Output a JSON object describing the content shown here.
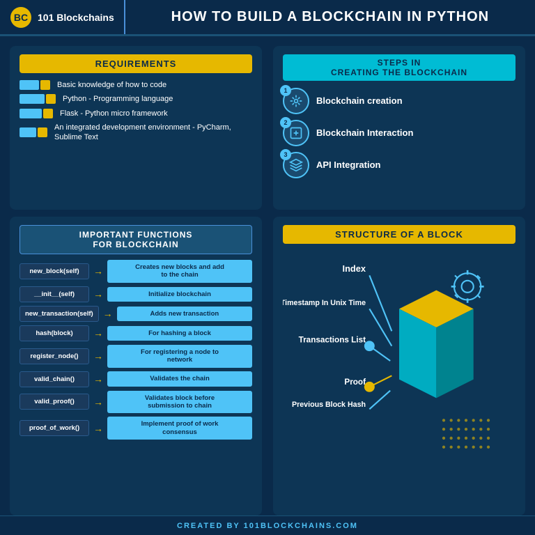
{
  "header": {
    "logo_text": "101 Blockchains",
    "title": "HOW TO BUILD A BLOCKCHAIN IN PYTHON"
  },
  "requirements": {
    "section_title": "REQUIREMENTS",
    "items": [
      {
        "text": "Basic knowledge of how to code"
      },
      {
        "text": "Python - Programming language"
      },
      {
        "text": "Flask - Python micro framework"
      },
      {
        "text": "An integrated development environment - PyCharm, Sublime Text"
      }
    ]
  },
  "steps": {
    "section_title": "STEPS IN\nCREATING THE BLOCKCHAIN",
    "items": [
      {
        "number": "1",
        "label": "Blockchain creation"
      },
      {
        "number": "2",
        "label": "Blockchain Interaction"
      },
      {
        "number": "3",
        "label": "API Integration"
      }
    ]
  },
  "functions": {
    "section_title": "IMPORTANT FUNCTIONS\nFOR BLOCKCHAIN",
    "items": [
      {
        "name": "new_block(self)",
        "desc": "Creates new blocks and add\nto the chain"
      },
      {
        "name": "__init__(self)",
        "desc": "Initialize blockchain"
      },
      {
        "name": "new_transaction(self)",
        "desc": "Adds new transaction"
      },
      {
        "name": "hash(block)",
        "desc": "For hashing a block"
      },
      {
        "name": "register_node()",
        "desc": "For registering a node to\nnetwork"
      },
      {
        "name": "valid_chain()",
        "desc": "Validates the chain"
      },
      {
        "name": "valid_proof()",
        "desc": "Validates block before\nsubmission to chain"
      },
      {
        "name": "proof_of_work()",
        "desc": "Implement proof of work\nconsensus"
      }
    ],
    "arrow": "→"
  },
  "block_structure": {
    "section_title": "STRUCTURE OF A BLOCK",
    "labels": [
      "Index",
      "Timestamp In Unix Time",
      "Transactions List",
      "Proof",
      "Previous Block Hash"
    ]
  },
  "footer": {
    "text": "CREATED BY 101BLOCKCHAINS.COM"
  }
}
